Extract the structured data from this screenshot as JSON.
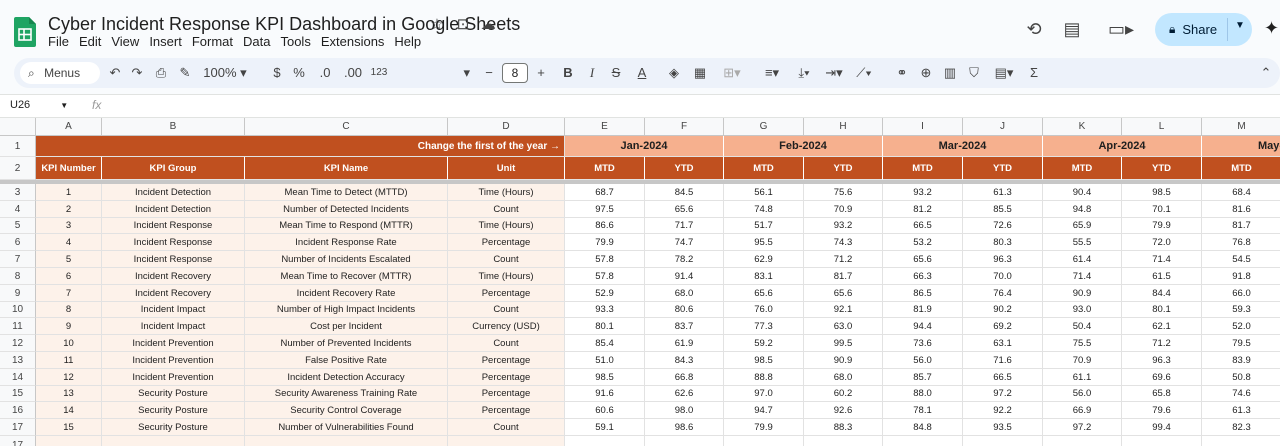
{
  "app": {
    "title": "Cyber Incident Response KPI Dashboard in Google Sheets",
    "menus": [
      "File",
      "Edit",
      "View",
      "Insert",
      "Format",
      "Data",
      "Tools",
      "Extensions",
      "Help"
    ],
    "share_label": "Share"
  },
  "toolbar": {
    "menus_label": "Menus",
    "zoom": "100%",
    "currency": "$",
    "percent": "%",
    "dec_dec": ".0",
    "inc_dec": ".00",
    "number_format": "123",
    "font_size": "8"
  },
  "formula": {
    "cell_ref": "U26",
    "fx": "fx",
    "value": ""
  },
  "columns": [
    "A",
    "B",
    "C",
    "D",
    "E",
    "F",
    "G",
    "H",
    "I",
    "J",
    "K",
    "L",
    "M"
  ],
  "header": {
    "banner": "Change the first of the year →",
    "months": [
      "Jan-2024",
      "Feb-2024",
      "Mar-2024",
      "Apr-2024",
      "May-"
    ],
    "kpi_number": "KPI Number",
    "kpi_group": "KPI Group",
    "kpi_name": "KPI Name",
    "unit": "Unit",
    "mtd": "MTD",
    "ytd": "YTD"
  },
  "rows": [
    {
      "n": "1",
      "group": "Incident Detection",
      "name": "Mean Time to Detect (MTTD)",
      "unit": "Time (Hours)",
      "vals": [
        "68.7",
        "84.5",
        "56.1",
        "75.6",
        "93.2",
        "61.3",
        "90.4",
        "98.5",
        "68.4"
      ]
    },
    {
      "n": "2",
      "group": "Incident Detection",
      "name": "Number of Detected Incidents",
      "unit": "Count",
      "vals": [
        "97.5",
        "65.6",
        "74.8",
        "70.9",
        "81.2",
        "85.5",
        "94.8",
        "70.1",
        "81.6"
      ]
    },
    {
      "n": "3",
      "group": "Incident Response",
      "name": "Mean Time to Respond (MTTR)",
      "unit": "Time (Hours)",
      "vals": [
        "86.6",
        "71.7",
        "51.7",
        "93.2",
        "66.5",
        "72.6",
        "65.9",
        "79.9",
        "81.7"
      ]
    },
    {
      "n": "4",
      "group": "Incident Response",
      "name": "Incident Response Rate",
      "unit": "Percentage",
      "vals": [
        "79.9",
        "74.7",
        "95.5",
        "74.3",
        "53.2",
        "80.3",
        "55.5",
        "72.0",
        "76.8"
      ]
    },
    {
      "n": "5",
      "group": "Incident Response",
      "name": "Number of Incidents Escalated",
      "unit": "Count",
      "vals": [
        "57.8",
        "78.2",
        "62.9",
        "71.2",
        "65.6",
        "96.3",
        "61.4",
        "71.4",
        "54.5"
      ]
    },
    {
      "n": "6",
      "group": "Incident Recovery",
      "name": "Mean Time to Recover (MTTR)",
      "unit": "Time (Hours)",
      "vals": [
        "57.8",
        "91.4",
        "83.1",
        "81.7",
        "66.3",
        "70.0",
        "71.4",
        "61.5",
        "91.8"
      ]
    },
    {
      "n": "7",
      "group": "Incident Recovery",
      "name": "Incident Recovery Rate",
      "unit": "Percentage",
      "vals": [
        "52.9",
        "68.0",
        "65.6",
        "65.6",
        "86.5",
        "76.4",
        "90.9",
        "84.4",
        "66.0"
      ]
    },
    {
      "n": "8",
      "group": "Incident Impact",
      "name": "Number of High Impact Incidents",
      "unit": "Count",
      "vals": [
        "93.3",
        "80.6",
        "76.0",
        "92.1",
        "81.9",
        "90.2",
        "93.0",
        "80.1",
        "59.3"
      ]
    },
    {
      "n": "9",
      "group": "Incident Impact",
      "name": "Cost per Incident",
      "unit": "Currency (USD)",
      "vals": [
        "80.1",
        "83.7",
        "77.3",
        "63.0",
        "94.4",
        "69.2",
        "50.4",
        "62.1",
        "52.0"
      ]
    },
    {
      "n": "10",
      "group": "Incident Prevention",
      "name": "Number of Prevented Incidents",
      "unit": "Count",
      "vals": [
        "85.4",
        "61.9",
        "59.2",
        "99.5",
        "73.6",
        "63.1",
        "75.5",
        "71.2",
        "79.5"
      ]
    },
    {
      "n": "11",
      "group": "Incident Prevention",
      "name": "False Positive Rate",
      "unit": "Percentage",
      "vals": [
        "51.0",
        "84.3",
        "98.5",
        "90.9",
        "56.0",
        "71.6",
        "70.9",
        "96.3",
        "83.9"
      ]
    },
    {
      "n": "12",
      "group": "Incident Prevention",
      "name": "Incident Detection Accuracy",
      "unit": "Percentage",
      "vals": [
        "98.5",
        "66.8",
        "88.8",
        "68.0",
        "85.7",
        "66.5",
        "61.1",
        "69.6",
        "50.8"
      ]
    },
    {
      "n": "13",
      "group": "Security Posture",
      "name": "Security Awareness Training Rate",
      "unit": "Percentage",
      "vals": [
        "91.6",
        "62.6",
        "97.0",
        "60.2",
        "88.0",
        "97.2",
        "56.0",
        "65.8",
        "74.6"
      ]
    },
    {
      "n": "14",
      "group": "Security Posture",
      "name": "Security Control Coverage",
      "unit": "Percentage",
      "vals": [
        "60.6",
        "98.0",
        "94.7",
        "92.6",
        "78.1",
        "92.2",
        "66.9",
        "79.6",
        "61.3"
      ]
    },
    {
      "n": "15",
      "group": "Security Posture",
      "name": "Number of Vulnerabilities Found",
      "unit": "Count",
      "vals": [
        "59.1",
        "98.6",
        "79.9",
        "88.3",
        "84.8",
        "93.5",
        "97.2",
        "99.4",
        "82.3"
      ]
    }
  ],
  "row_numbers": [
    "1",
    "2",
    "3",
    "4",
    "5",
    "6",
    "7",
    "8",
    "9",
    "10",
    "11",
    "12",
    "13",
    "14",
    "15",
    "16",
    "17"
  ]
}
